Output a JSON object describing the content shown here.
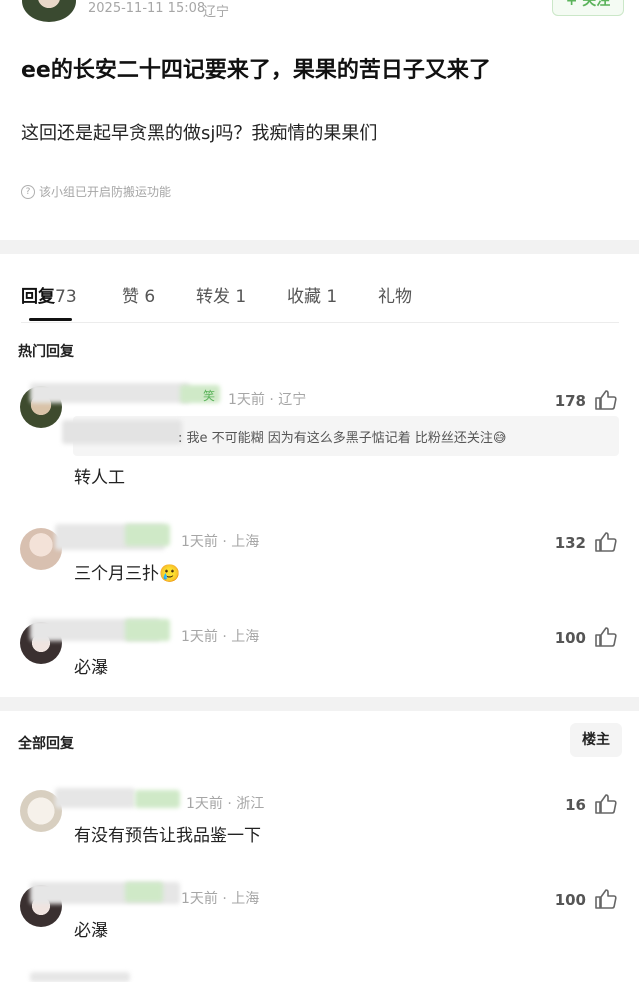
{
  "post": {
    "timestamp": "2025-11-11 15:08",
    "location": "辽宁",
    "follow_label": "+ 关注",
    "title": "ee的长安二十四记要来了，果果的苦日子又来了",
    "body": "这回还是起早贪黑的做sj吗？我痴情的果果们",
    "notice": "该小组已开启防搬运功能"
  },
  "tabs": [
    {
      "label": "回复",
      "count": "73"
    },
    {
      "label": "赞",
      "count": "6"
    },
    {
      "label": "转发",
      "count": "1"
    },
    {
      "label": "收藏",
      "count": "1"
    },
    {
      "label": "礼物",
      "count": ""
    }
  ],
  "hot_section": {
    "title": "热门回复",
    "comments": [
      {
        "badge": "笑",
        "meta": "1天前 · 辽宁",
        "likes": "178",
        "quote": ": 我e 不可能糊 因为有这么多黑子惦记着 比粉丝还关注😅",
        "text": "转人工"
      },
      {
        "meta": "1天前 · 上海",
        "likes": "132",
        "text": "三个月三扑🥲"
      },
      {
        "meta": "1天前 · 上海",
        "likes": "100",
        "text": "必瀑"
      }
    ]
  },
  "all_section": {
    "title": "全部回复",
    "owner_button": "楼主",
    "comments": [
      {
        "meta": "1天前 · 浙江",
        "likes": "16",
        "text": "有没有预告让我品鉴一下"
      },
      {
        "meta": "1天前 · 上海",
        "likes": "100",
        "text": "必瀑"
      }
    ]
  },
  "colors": {
    "accent_green": "#5bb35b",
    "divider_gray": "#f2f2f2",
    "muted_text": "#a6a6a6"
  }
}
